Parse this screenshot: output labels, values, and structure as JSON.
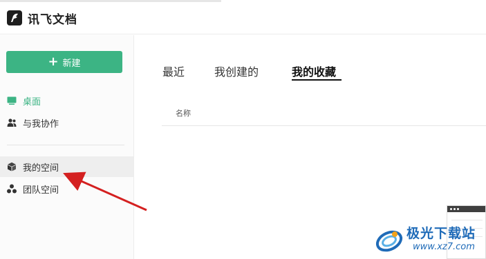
{
  "app": {
    "title": "讯飞文档"
  },
  "sidebar": {
    "new_label": "新建",
    "items": [
      {
        "label": "桌面",
        "icon": "monitor-icon",
        "active": true
      },
      {
        "label": "与我协作",
        "icon": "users-icon"
      },
      {
        "label": "我的空间",
        "icon": "cube-icon",
        "hovered": true
      },
      {
        "label": "团队空间",
        "icon": "team-icon"
      }
    ]
  },
  "main": {
    "tabs": [
      {
        "label": "最近"
      },
      {
        "label": "我创建的"
      },
      {
        "label": "我的收藏",
        "active": true
      }
    ],
    "columns": {
      "name": "名称"
    }
  },
  "watermark": {
    "text": "极光下载站",
    "url": "www.xz7.com"
  },
  "colors": {
    "accent": "#3cb484",
    "arrow": "#d42020",
    "watermark": "#1f6bb8"
  }
}
